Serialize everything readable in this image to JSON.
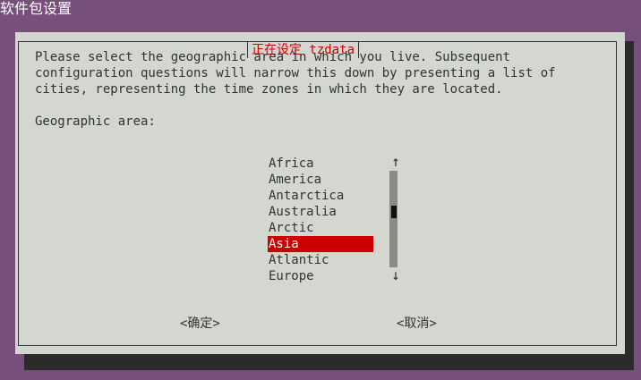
{
  "window": {
    "title": "软件包设置"
  },
  "dialog": {
    "title": "正在设定 tzdata",
    "description_lines": [
      "Please select the geographic area in which you live. Subsequent",
      "configuration questions will narrow this down by presenting a list of",
      "cities, representing the time zones in which they are located."
    ],
    "prompt": "Geographic area:",
    "list": {
      "items": [
        "Africa",
        "America",
        "Antarctica",
        "Australia",
        "Arctic",
        "Asia",
        "Atlantic",
        "Europe"
      ],
      "selected": "Asia"
    },
    "scroll": {
      "up_glyph": "↑",
      "down_glyph": "↓"
    },
    "buttons": {
      "ok": "<确定>",
      "cancel": "<取消>"
    }
  },
  "colors": {
    "desktop": "#76507a",
    "dialog_bg": "#d3d7cf",
    "accent": "#cc0000",
    "shadow": "#2b2b2b"
  }
}
